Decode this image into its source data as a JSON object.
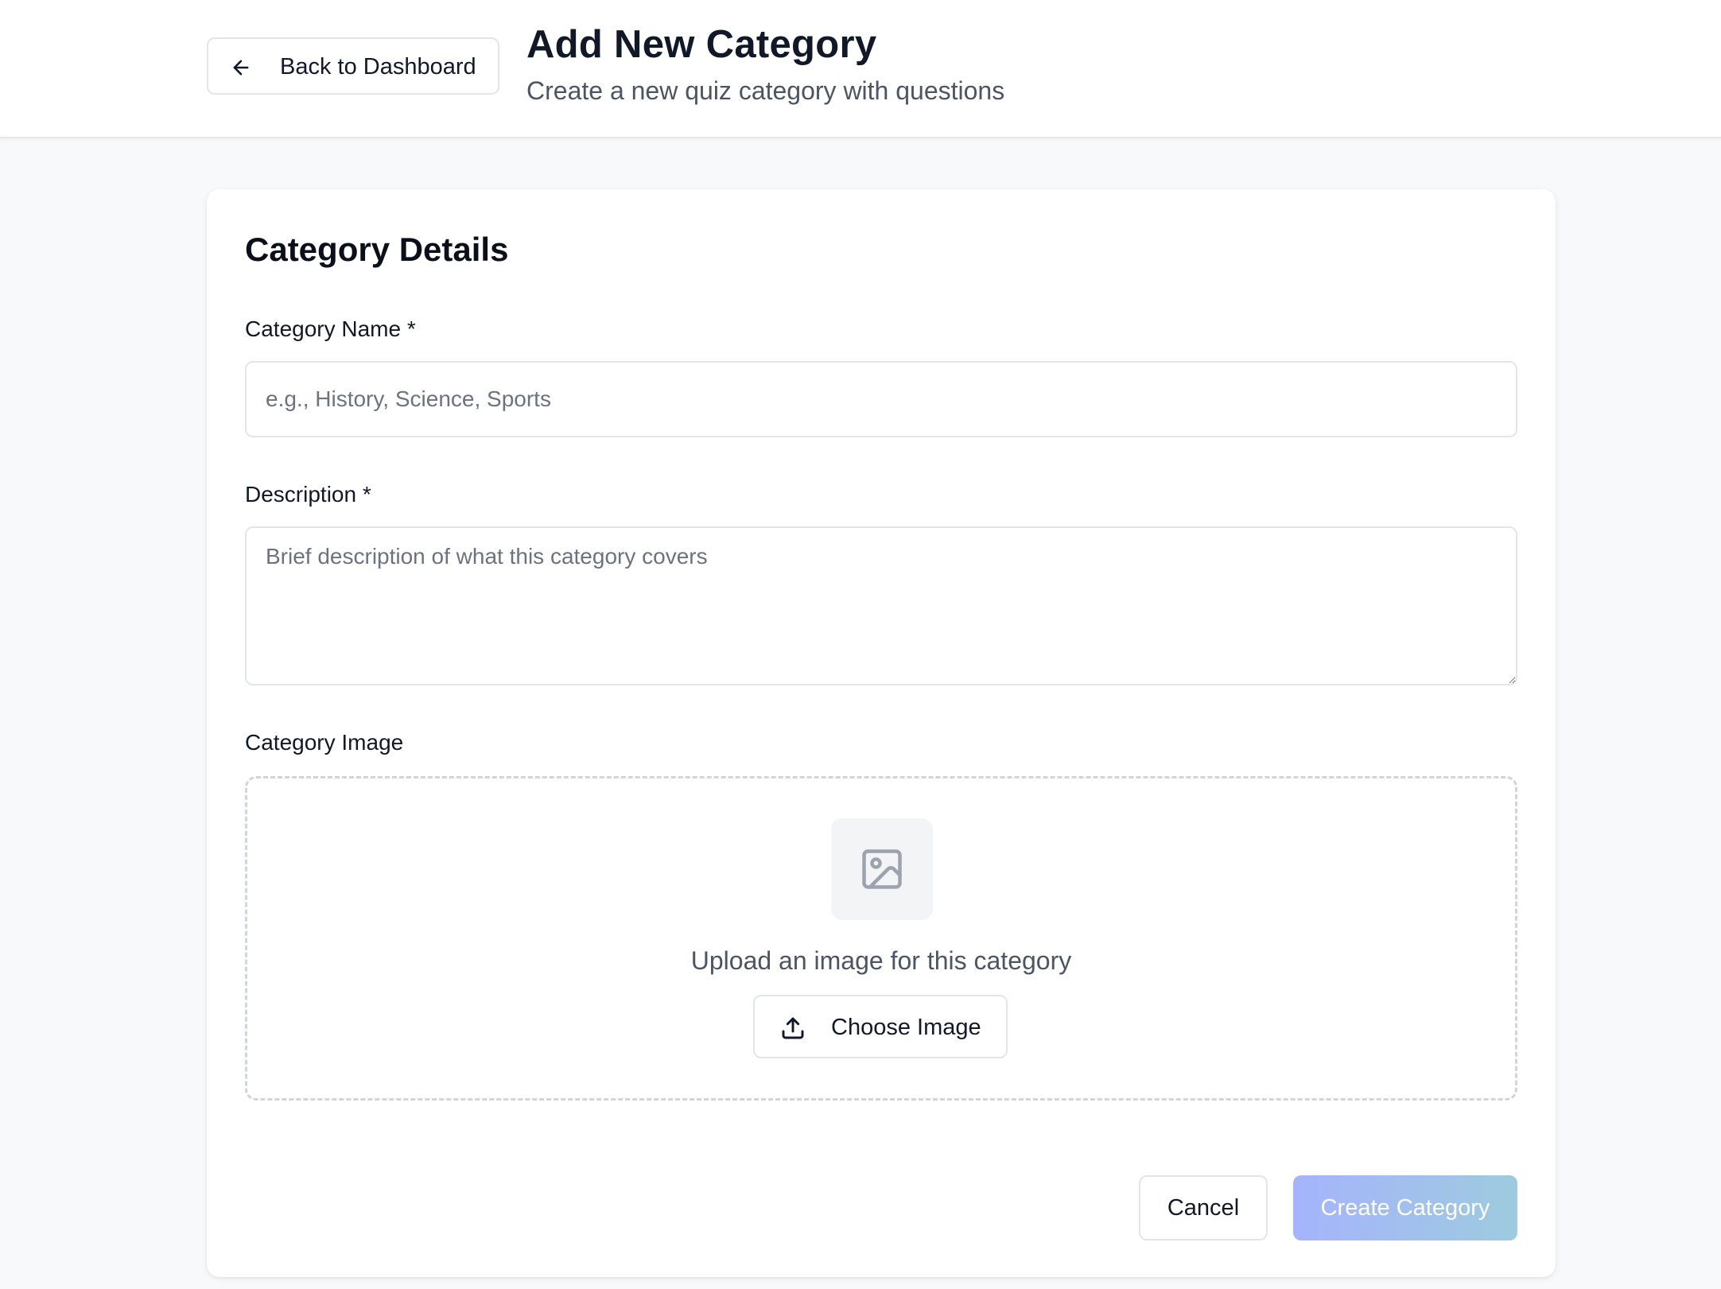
{
  "header": {
    "back_label": "Back to Dashboard",
    "title": "Add New Category",
    "subtitle": "Create a new quiz category with questions"
  },
  "form": {
    "section_title": "Category Details",
    "name": {
      "label": "Category Name *",
      "placeholder": "e.g., History, Science, Sports",
      "value": ""
    },
    "description": {
      "label": "Description *",
      "placeholder": "Brief description of what this category covers",
      "value": ""
    },
    "image": {
      "label": "Category Image",
      "prompt": "Upload an image for this category",
      "choose_label": "Choose Image",
      "icon": "image-icon"
    },
    "actions": {
      "cancel_label": "Cancel",
      "create_label": "Create Category",
      "create_enabled": false
    }
  },
  "colors": {
    "background": "#f8f9fa",
    "card": "#ffffff",
    "border": "#e2e5ea",
    "text_primary": "#111827",
    "text_muted": "#4b5563",
    "create_gradient_start": "#a5b4fc",
    "create_gradient_end": "#9ecbdf"
  }
}
